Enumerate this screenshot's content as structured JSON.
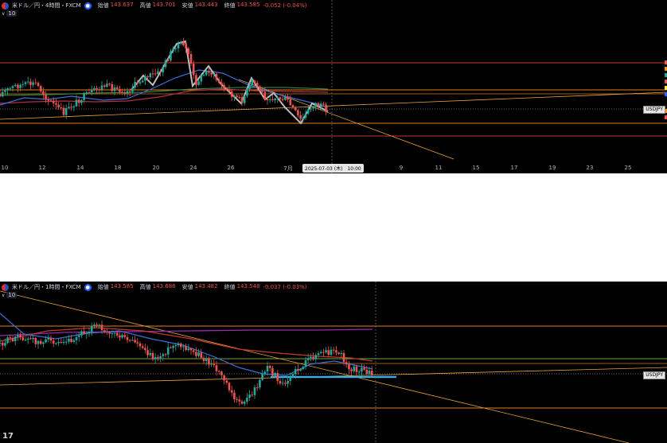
{
  "top": {
    "title": "米ドル／円・4時間・FXCM",
    "ohlc": [
      {
        "label": "始値",
        "value": "143.637"
      },
      {
        "label": "高値",
        "value": "143.701"
      },
      {
        "label": "安値",
        "value": "143.443"
      },
      {
        "label": "終値",
        "value": "143.585"
      }
    ],
    "change": "-0.052 (-0.04%)",
    "indicator_value": "10",
    "symbol_tag": "USDJPY",
    "crosshair_date": "2025-07-03 (木)　10:00",
    "x_labels": [
      "10",
      "12",
      "14",
      "18",
      "20",
      "24",
      "26",
      "7月",
      "9",
      "11",
      "15",
      "17",
      "19",
      "23",
      "25"
    ],
    "side_marker_colors": [
      "#ef5350",
      "#ff9800",
      "#26a69a",
      "#ef5350",
      "#ffeb3b",
      "#2962ff",
      "#ff9800",
      "#ef5350"
    ]
  },
  "bottom": {
    "title": "米ドル／円・1時間・FXCM",
    "ohlc": [
      {
        "label": "始値",
        "value": "143.585"
      },
      {
        "label": "高値",
        "value": "143.686"
      },
      {
        "label": "安値",
        "value": "143.482"
      },
      {
        "label": "終値",
        "value": "143.548"
      }
    ],
    "change": "-0.037 (-0.03%)",
    "indicator_value": "10",
    "symbol_tag": "USDJPY",
    "logo_text": "17"
  },
  "colors": {
    "background": "#000000",
    "up_candle": "#26a69a",
    "down_candle": "#ef5350",
    "text": "#d1d4dc",
    "negative": "#ef5350"
  }
}
